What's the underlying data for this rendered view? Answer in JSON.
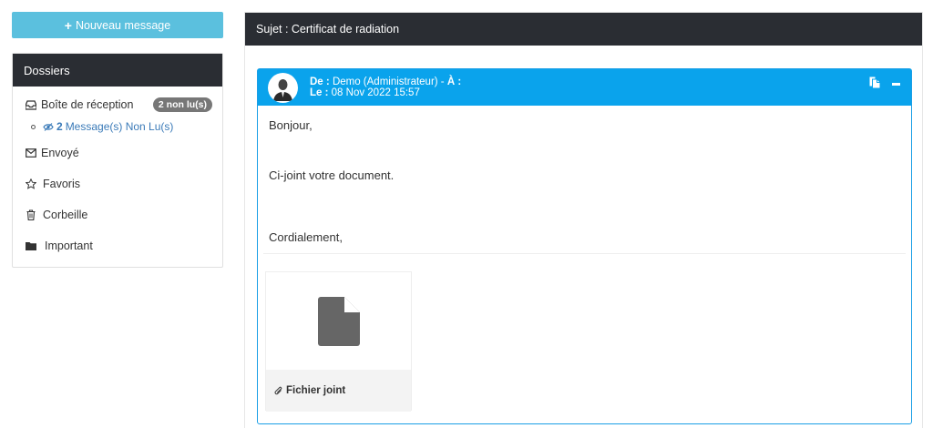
{
  "new_message_button": {
    "label": "Nouveau message"
  },
  "folders": {
    "title": "Dossiers",
    "inbox": {
      "label": "Boîte de réception",
      "badge": "2 non lu(s)"
    },
    "unread": {
      "count": "2",
      "label": "Message(s) Non Lu(s)"
    },
    "items": [
      {
        "label": "Envoyé",
        "icon": "envelope-icon"
      },
      {
        "label": "Favoris",
        "icon": "star-icon"
      },
      {
        "label": "Corbeille",
        "icon": "trash-icon"
      },
      {
        "label": "Important",
        "icon": "folder-icon"
      }
    ]
  },
  "subject": {
    "text": "Sujet : Certificat de radiation"
  },
  "message": {
    "from_label": "De :",
    "from_value": "Demo (Administrateur) -",
    "to_label": "À :",
    "date_label": "Le :",
    "date_value": "08 Nov 2022 15:57",
    "lines": [
      "Bonjour,",
      "Ci-joint votre document.",
      "Cordialement,"
    ],
    "attachment_label": "Fichier joint"
  },
  "colors": {
    "accent": "#0aa3ec",
    "dark_header": "#2a2d33",
    "button": "#5bc0de",
    "badge": "#777777"
  }
}
